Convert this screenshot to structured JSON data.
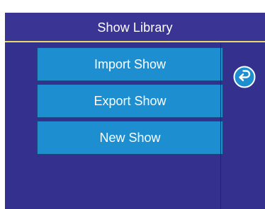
{
  "header": {
    "title": "Show Library"
  },
  "menu": {
    "items": [
      {
        "label": "Import Show"
      },
      {
        "label": "Export Show"
      },
      {
        "label": "New Show"
      }
    ]
  },
  "side": {
    "back_icon": "return-arrow-icon"
  },
  "colors": {
    "panel_background": "#33308e",
    "header_line": "#e7d96a",
    "button_background": "#1d8fd1",
    "text": "#ffffff"
  }
}
